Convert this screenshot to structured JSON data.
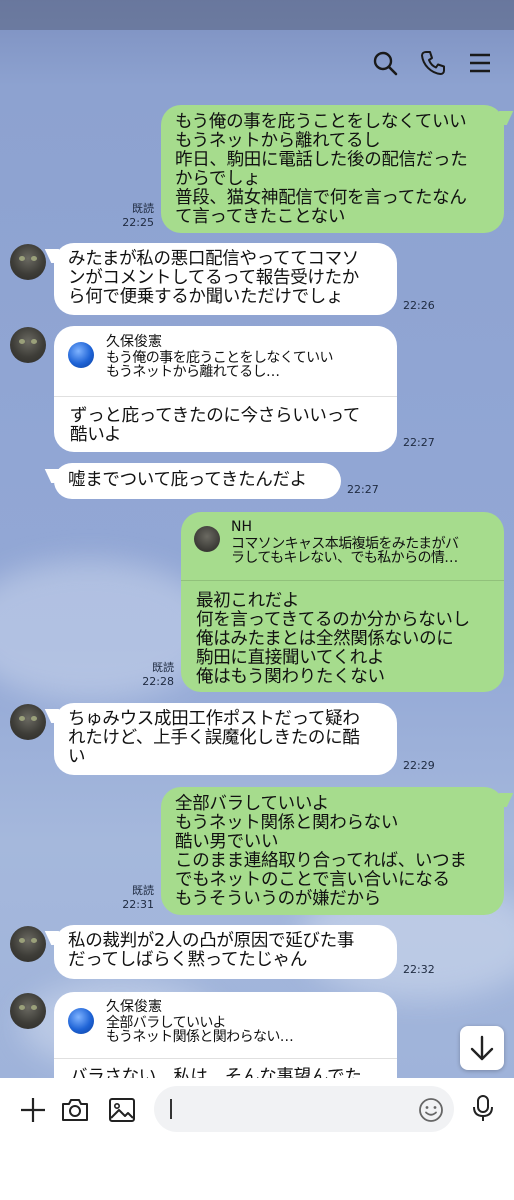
{
  "header": {
    "icons": [
      "search-icon",
      "phone-icon",
      "menu-icon"
    ]
  },
  "messages": [
    {
      "id": "m1",
      "side": "out",
      "type": "text",
      "text": "もう俺の事を庇うことをしなくていい\nもうネットから離れてるし\n昨日、駒田に電話した後の配信だった\nからでしょ\n普段、猫女神配信で何を言ってたなん\nて言ってきたことない",
      "read": "既読",
      "time": "22:25"
    },
    {
      "id": "m2",
      "side": "in",
      "type": "text",
      "text": "みたまが私の悪口配信やっててコマソ\nンがコメントしてるって報告受けたか\nら何で便乗するか聞いただけでしょ",
      "time": "22:26"
    },
    {
      "id": "m3",
      "side": "in",
      "type": "reply",
      "reply_name": "久保俊憲",
      "reply_quote": "もう俺の事を庇うことをしなくていい\nもうネットから離れてるし…",
      "text": "ずっと庇ってきたのに今さらいいって\n酷いよ",
      "time": "22:27"
    },
    {
      "id": "m4",
      "side": "in",
      "type": "text",
      "text": "嘘までついて庇ってきたんだよ",
      "time": "22:27"
    },
    {
      "id": "m5",
      "side": "out",
      "type": "reply",
      "reply_name": "NH",
      "reply_quote": "コマソンキャス本垢複垢をみたまがバ\nラしてもキレない、でも私からの情…",
      "text": "最初これだよ\n何を言ってきてるのか分からないし\n俺はみたまとは全然関係ないのに\n駒田に直接聞いてくれよ\n俺はもう関わりたくない",
      "read": "既読",
      "time": "22:28"
    },
    {
      "id": "m6",
      "side": "in",
      "type": "text",
      "text": "ちゅみウス成田工作ポストだって疑わ\nれたけど、上手く誤魔化しきたのに酷\nい",
      "time": "22:29"
    },
    {
      "id": "m7",
      "side": "out",
      "type": "text",
      "text": "全部バラしていいよ\nもうネット関係と関わらない\n酷い男でいい\nこのまま連絡取り合ってれば、いつま\nでもネットのことで言い合いになる\nもうそういうのが嫌だから",
      "read": "既読",
      "time": "22:31"
    },
    {
      "id": "m8",
      "side": "in",
      "type": "text",
      "text": "私の裁判が2人の凸が原因で延びた事\nだってしばらく黙ってたじゃん",
      "time": "22:32"
    },
    {
      "id": "m9",
      "side": "in",
      "type": "reply",
      "reply_name": "久保俊憲",
      "reply_quote": "全部バラしていいよ\nもうネット関係と関わらない…",
      "text": "バラさない、私は、そんな事望んでた",
      "time": ""
    }
  ],
  "input": {
    "placeholder": "",
    "value": ""
  },
  "toolbar": {
    "icons": [
      "plus-icon",
      "camera-icon",
      "image-icon",
      "emoji-icon",
      "mic-icon"
    ]
  },
  "colors": {
    "outgoing_bubble": "#a6dc8d",
    "incoming_bubble": "#ffffff",
    "chat_background": "#93a8d6"
  }
}
